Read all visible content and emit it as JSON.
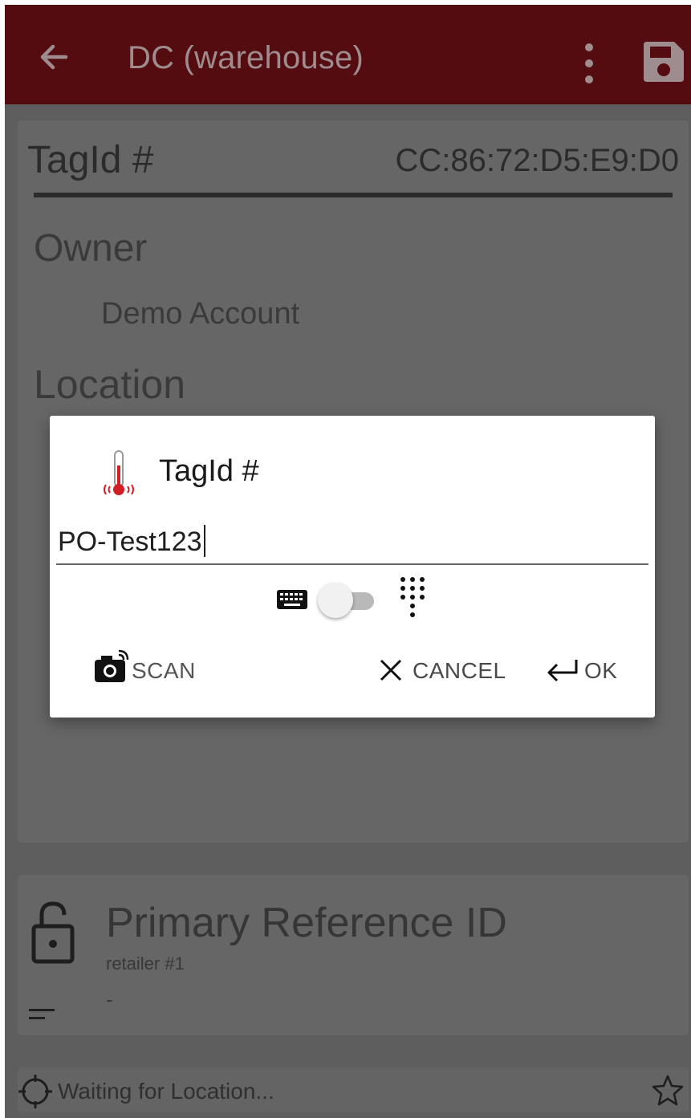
{
  "appbar": {
    "title": "DC (warehouse)",
    "background": "#540c11",
    "icons": [
      "arrow-back-icon",
      "more-vert-icon",
      "save-icon"
    ]
  },
  "form": {
    "tag_label": "TagId #",
    "tag_value": "CC:86:72:D5:E9:D0",
    "owner_label": "Owner",
    "owner_value": "Demo Account",
    "location_label": "Location"
  },
  "reference": {
    "title": "Primary Reference ID",
    "subtitle": "retailer #1",
    "value": "-"
  },
  "status": {
    "text": "Waiting for Location..."
  },
  "dialog": {
    "title": "TagId #",
    "icon": "thermometer-icon",
    "input_value": "PO-Test123",
    "toggle_on": false,
    "scan_label": "SCAN",
    "cancel_label": "CANCEL",
    "ok_label": "OK"
  }
}
